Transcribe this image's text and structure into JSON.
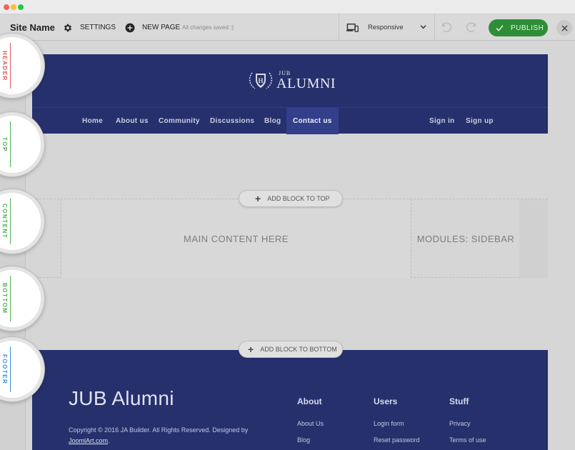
{
  "toolbar": {
    "site_name": "Site Name",
    "settings_label": "SETTINGS",
    "new_page_label": "NEW PAGE",
    "saved_status": "All changes saved :)",
    "responsive_label": "Responsive",
    "publish_label": "PUBLISH"
  },
  "side_tabs": [
    {
      "label": "HEADER",
      "color": "#e05a5a"
    },
    {
      "label": "TOP",
      "color": "#4caf50"
    },
    {
      "label": "CONTENT",
      "color": "#4caf50"
    },
    {
      "label": "BOTTOM",
      "color": "#4caf50"
    },
    {
      "label": "FOOTER",
      "color": "#3a8fd8"
    }
  ],
  "site_header": {
    "logo_small": "JUB",
    "logo_big": "ALUMNI",
    "nav": [
      "Home",
      "About us",
      "Community",
      "Discussions",
      "Blog",
      "Contact us"
    ],
    "nav_active": "Contact us",
    "auth": [
      "Sign in",
      "Sign up"
    ]
  },
  "blocks": {
    "add_top": "ADD BLOCK TO TOP",
    "main_content": "MAIN CONTENT HERE",
    "sidebar": "MODULES: SIDEBAR",
    "add_bottom": "ADD BLOCK TO BOTTOM"
  },
  "footer": {
    "brand": "JUB Alumni",
    "copyright": "Copyright © 2016 JA Builder. All Rights Reserved. Designed by",
    "designer_link": "JoomlArt.com",
    "designer_suffix": ".",
    "columns": [
      {
        "title": "About",
        "links": [
          "About Us",
          "Blog"
        ]
      },
      {
        "title": "Users",
        "links": [
          "Login form",
          "Reset password"
        ]
      },
      {
        "title": "Stuff",
        "links": [
          "Privacy",
          "Terms of use"
        ]
      }
    ]
  },
  "colors": {
    "brand_navy": "#26306d",
    "publish_green": "#2e8e37"
  }
}
